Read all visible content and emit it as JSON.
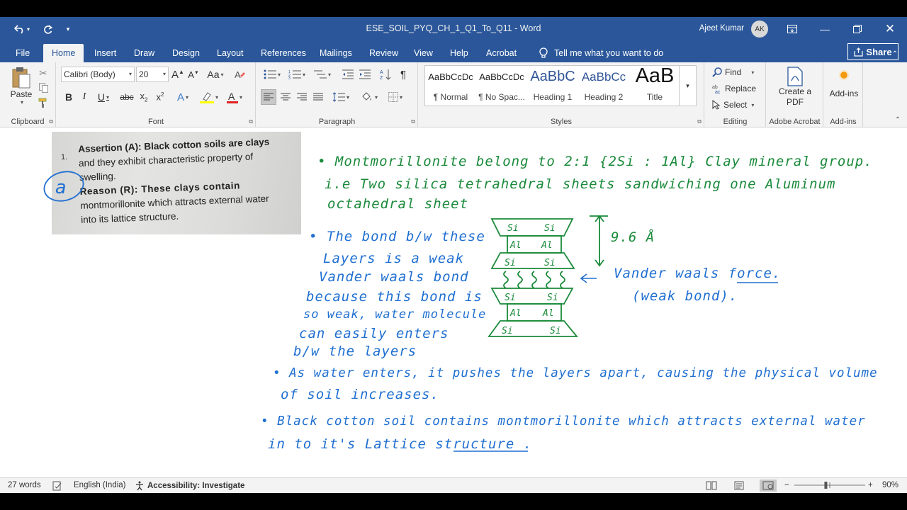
{
  "titlebar": {
    "doc_title": "ESE_SOIL_PYQ_CH_1_Q1_To_Q11  -  Word",
    "user_name": "Ajeet Kumar",
    "avatar_initials": "AK"
  },
  "tabs": [
    "File",
    "Home",
    "Insert",
    "Draw",
    "Design",
    "Layout",
    "References",
    "Mailings",
    "Review",
    "View",
    "Help",
    "Acrobat"
  ],
  "tell_me": "Tell me what you want to do",
  "share_label": "Share",
  "ribbon": {
    "clipboard": {
      "paste": "Paste",
      "label": "Clipboard"
    },
    "font": {
      "family": "Calibri (Body)",
      "size": "20",
      "label": "Font"
    },
    "paragraph": {
      "label": "Paragraph"
    },
    "styles": {
      "label": "Styles",
      "items": [
        {
          "sample": "AaBbCcDc",
          "name": "¶ Normal"
        },
        {
          "sample": "AaBbCcDc",
          "name": "¶ No Spac..."
        },
        {
          "sample": "AaBbC",
          "name": "Heading 1"
        },
        {
          "sample": "AaBbCc",
          "name": "Heading 2"
        },
        {
          "sample": "AaB",
          "name": "Title"
        }
      ]
    },
    "editing": {
      "find": "Find",
      "replace": "Replace",
      "select": "Select",
      "label": "Editing"
    },
    "acrobat": {
      "create_pdf": "Create a PDF",
      "label": "Adobe Acrobat"
    },
    "addins": {
      "button": "Add-ins",
      "label": "Add-ins"
    }
  },
  "photo": {
    "number": "1.",
    "lines": [
      "Assertion (A): Black cotton soils are clays",
      "and they exhibit characteristic property of",
      "swelling.",
      "Reason (R): These clays contain",
      "montmorillonite which attracts external water",
      "into its lattice structure."
    ],
    "answer_mark": "a"
  },
  "notes": {
    "green": [
      "• Montmorillonite belong to 2:1 {2Si : 1Al} Clay mineral group.",
      "i.e  Two silica tetrahedral sheets sandwiching one Aluminum",
      "octahedral sheet"
    ],
    "blue": [
      "• The bond b/w these",
      "Layers is a weak",
      "Vander waals bond",
      "because this bond is",
      "so weak, water molecule",
      "can easily enters",
      "b/w the layers",
      "• As water enters, it pushes the layers apart, causing the physical volume",
      "of soil increases.",
      "• Black cotton soil contains montmorillonite which attracts external water",
      "in to it's Lattice structure ."
    ],
    "diagram": {
      "si": "Si",
      "al": "Al",
      "spacing": "9.6 Å",
      "force_label": "Vander waals force.",
      "weak_label": "(weak bond)."
    }
  },
  "statusbar": {
    "words": "27 words",
    "language": "English (India)",
    "accessibility": "Accessibility: Investigate",
    "zoom": "90%",
    "zoom_level": 0.9
  },
  "colors": {
    "brand": "#2b579a",
    "ink_green": "#1a8a3a",
    "ink_blue": "#1f6fd1"
  }
}
